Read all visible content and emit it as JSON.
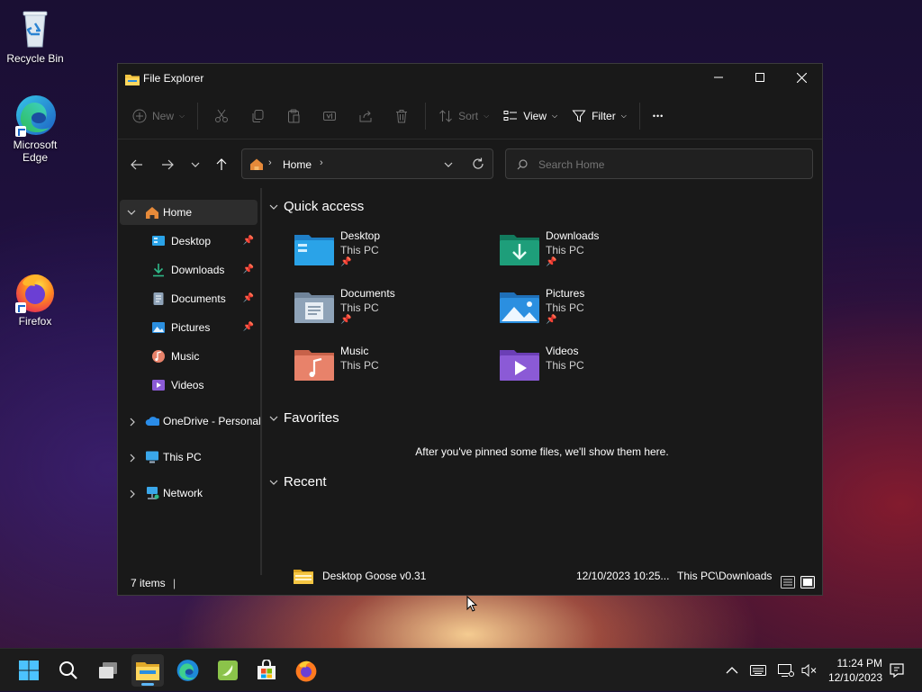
{
  "desktop": {
    "icons": [
      {
        "label": "Recycle Bin"
      },
      {
        "label_line1": "Microsoft",
        "label_line2": "Edge"
      },
      {
        "label": "Firefox"
      }
    ]
  },
  "window": {
    "title": "File Explorer",
    "toolbar": {
      "new_label": "New",
      "sort_label": "Sort",
      "view_label": "View",
      "filter_label": "Filter",
      "more_label": "•••"
    },
    "address": {
      "location": "Home"
    },
    "search": {
      "placeholder": "Search Home"
    },
    "nav_pane": {
      "items": [
        {
          "label": "Home",
          "icon": "home-icon"
        },
        {
          "label": "Desktop",
          "icon": "desktop-folder-icon",
          "pinned": true
        },
        {
          "label": "Downloads",
          "icon": "downloads-icon",
          "pinned": true
        },
        {
          "label": "Documents",
          "icon": "documents-icon",
          "pinned": true
        },
        {
          "label": "Pictures",
          "icon": "pictures-icon",
          "pinned": true
        },
        {
          "label": "Music",
          "icon": "music-icon"
        },
        {
          "label": "Videos",
          "icon": "videos-icon"
        },
        {
          "label": "OneDrive - Personal",
          "icon": "onedrive-icon"
        },
        {
          "label": "This PC",
          "icon": "this-pc-icon"
        },
        {
          "label": "Network",
          "icon": "network-icon"
        }
      ]
    },
    "quick_access": {
      "heading": "Quick access",
      "tiles": [
        {
          "name": "Desktop",
          "location": "This PC",
          "pinned": true,
          "color": "#2aa3e8"
        },
        {
          "name": "Downloads",
          "location": "This PC",
          "pinned": true,
          "color": "#1e9e7a"
        },
        {
          "name": "Documents",
          "location": "This PC",
          "pinned": true,
          "color": "#8fa3b8"
        },
        {
          "name": "Pictures",
          "location": "This PC",
          "pinned": true,
          "color": "#2b8fe0"
        },
        {
          "name": "Music",
          "location": "This PC",
          "pinned": false,
          "color": "#e8826a"
        },
        {
          "name": "Videos",
          "location": "This PC",
          "pinned": false,
          "color": "#8b5ad6"
        }
      ]
    },
    "favorites": {
      "heading": "Favorites",
      "empty_message": "After you've pinned some files, we'll show them here."
    },
    "recent": {
      "heading": "Recent",
      "items": [
        {
          "name": "Desktop Goose v0.31",
          "date": "12/10/2023 10:25...",
          "location": "This PC\\Downloads"
        }
      ]
    },
    "status": {
      "items_count": "7 items"
    }
  },
  "taskbar": {
    "clock_time": "11:24 PM",
    "clock_date": "12/10/2023"
  }
}
